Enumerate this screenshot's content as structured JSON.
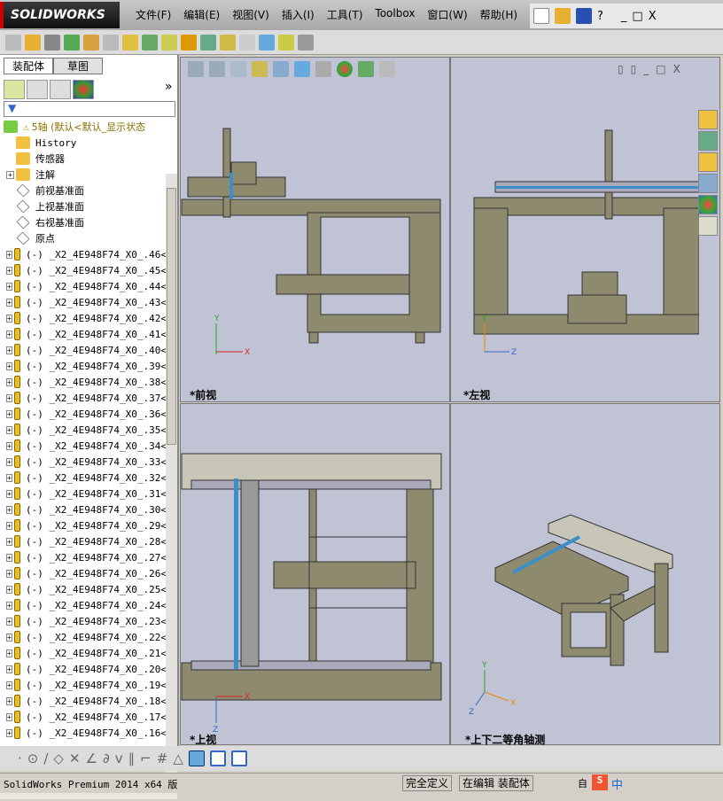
{
  "app": {
    "logo": "SOLIDWORKS"
  },
  "menu": [
    "文件(F)",
    "编辑(E)",
    "视图(V)",
    "插入(I)",
    "工具(T)",
    "Toolbox",
    "窗口(W)",
    "帮助(H)"
  ],
  "window_controls": {
    "help": "?",
    "minimize": "_",
    "restore": "□",
    "close": "X"
  },
  "panel": {
    "tabs": [
      "装配体",
      "草图"
    ],
    "expand": "»"
  },
  "tree": {
    "root": "5轴  (默认<默认_显示状态",
    "items": [
      "History",
      "传感器",
      "注解",
      "前视基准面",
      "上视基准面",
      "右视基准面",
      "原点"
    ],
    "component_prefix": "(-) _X2_4E948F74_X0_.",
    "component_numbers": [
      46,
      45,
      44,
      43,
      42,
      41,
      40,
      39,
      38,
      37,
      36,
      35,
      34,
      33,
      32,
      31,
      30,
      29,
      28,
      27,
      26,
      25,
      24,
      23,
      22,
      21,
      20,
      19,
      18,
      17,
      16
    ]
  },
  "viewports": {
    "front": "*前视",
    "left": "*左视",
    "top": "*上视",
    "iso": "*上下二等角轴测"
  },
  "axes": {
    "x": "X",
    "y": "Y",
    "z": "Z"
  },
  "status": {
    "product": "SolidWorks Premium 2014 x64 版",
    "definition": "完全定义",
    "mode": "在编辑 装配体",
    "ime": "自",
    "ime_lang": "中"
  },
  "colors": {
    "viewport_bg": "#bfc3d4",
    "machine": "#8e8a6e",
    "accent_blue": "#3a8fc8",
    "logo_bg": "#1a1a1a"
  }
}
